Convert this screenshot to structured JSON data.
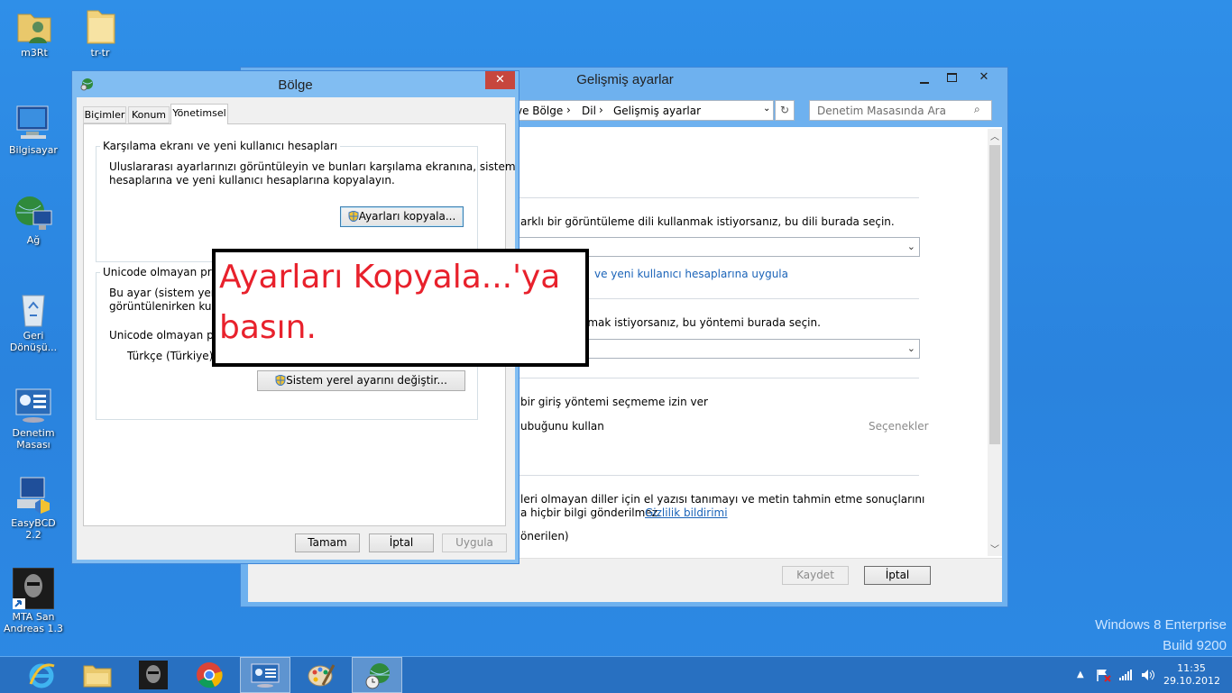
{
  "desktop": {
    "icons": [
      {
        "label": "m3Rt"
      },
      {
        "label": "tr-tr"
      },
      {
        "label": "Bilgisayar"
      },
      {
        "label": "Ağ"
      },
      {
        "label": "Geri Dönüşü..."
      },
      {
        "label": "Denetim Masası"
      },
      {
        "label": "EasyBCD 2.2"
      },
      {
        "label": "MTA San Andreas 1.3"
      }
    ],
    "watermark_line1": "Windows 8 Enterprise",
    "watermark_line2": "Build 9200"
  },
  "advanced_window": {
    "title": "Gelişmiş ayarlar",
    "breadcrumb": [
      "ve Bölge",
      "Dil",
      "Gelişmiş ayarlar"
    ],
    "search_placeholder": "Denetim Masasında Ara",
    "text_display_language": "arklı bir görüntüleme dili kullanmak istiyorsanız, bu dili burada seçin.",
    "link_apply": "ve yeni kullanıcı hesaplarına uygula",
    "text_input_method": "ntemi kullanmak istiyorsanız, bu yöntemi burada seçin.",
    "text_allow_input": "bir giriş yöntemi seçmeme izin ver",
    "text_language_bar": "ubuğunu kullan",
    "options_label": "Seçenekler",
    "text_handwriting_1": "leri olmayan diller için el yazısı tanımayı ve metin tahmin etme sonuçlarını",
    "text_handwriting_2": "a hiçbir bilgi gönderilmez.",
    "privacy_link": "Gizlilik bildirimi",
    "text_recommended": "önerilen)",
    "save_label": "Kaydet",
    "cancel_label": "İptal"
  },
  "region_dialog": {
    "title": "Bölge",
    "tabs": [
      "Biçimler",
      "Konum",
      "Yönetimsel"
    ],
    "group1_title": "Karşılama ekranı ve yeni kullanıcı hesapları",
    "group1_text_1": "Uluslararası ayarlarınızı görüntüleyin ve bunları karşılama ekranına, sistem",
    "group1_text_2": "hesaplarına ve yeni kullanıcı hesaplarına kopyalayın.",
    "copy_button": "Ayarları kopyala...",
    "group2_title": "Unicode olmayan prog",
    "group2_text_1": "Bu ayar (sistem yerel a",
    "group2_text_2": "görüntülenirken kulla",
    "group2_text_3": "Unicode olmayan prog",
    "current_locale": "Türkçe (Türkiye)",
    "change_locale_button": "Sistem yerel ayarını değiştir...",
    "ok_label": "Tamam",
    "cancel_label": "İptal",
    "apply_label": "Uygula"
  },
  "annotation": {
    "line1": "Ayarları Kopyala...'ya",
    "line2": "basın."
  },
  "tray": {
    "time": "11:35",
    "date": "29.10.2012"
  }
}
